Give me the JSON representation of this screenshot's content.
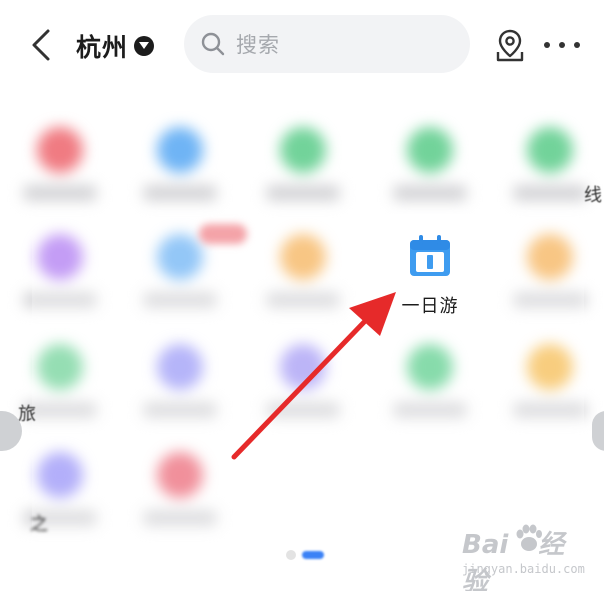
{
  "header": {
    "city": "杭州",
    "search_placeholder": "搜索"
  },
  "highlight_item": {
    "label": "一日游",
    "icon": "calendar-icon",
    "icon_color": "#3e9cf0"
  },
  "edge_texts": [
    "线",
    "旅",
    "之"
  ],
  "blurred_icon_colors": [
    [
      "#f07b82",
      "#6fb4f5",
      "#72d39a",
      "#72d39a",
      "#72d39a"
    ],
    [
      "#b07cf2",
      "#6fb4f5",
      "#f6b35b",
      "#3e9cf0",
      "#f6b35b"
    ],
    [
      "#72d39a",
      "#9d9cf7",
      "#a69cf5",
      "#5fcf8f",
      "#f6bd54"
    ],
    [
      "#9a95f8",
      "#ec6b7a"
    ]
  ],
  "annotation": {
    "arrow_color": "#e62a2a"
  },
  "watermark": {
    "brand": "Bai",
    "brand_tail": "经验",
    "url": "jingyan.baidu.com"
  }
}
